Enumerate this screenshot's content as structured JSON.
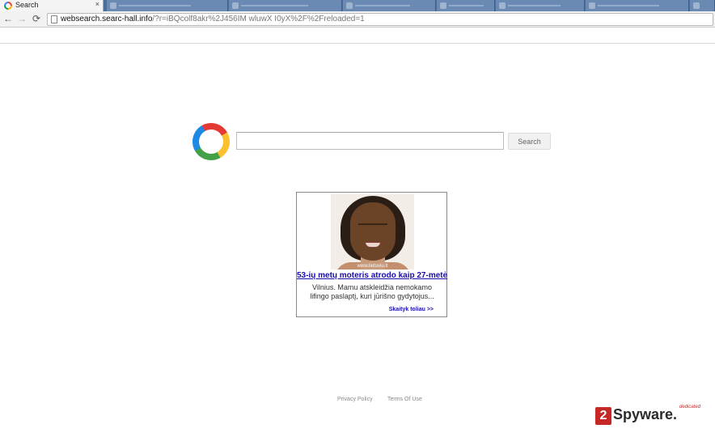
{
  "browser": {
    "active_tab": {
      "title": "Search",
      "close_glyph": "×"
    },
    "nav": {
      "back_glyph": "←",
      "forward_glyph": "→",
      "reload_glyph": "⟳"
    },
    "address_bar": {
      "url_host": "websearch.searc-hall.info",
      "url_rest": "/?r=iBQcolf8akr%2J456IM wluwX I0yX%2F%2Freloaded=1"
    }
  },
  "search": {
    "button_label": "Search",
    "query_value": ""
  },
  "ad": {
    "watermark": "www.lietuviu.lt",
    "headline": "53-ių metų moteris atrodo kaip 27-metė",
    "body": "Vilnius. Mamu atskleidžia nemokamo lifingo paslaptį, kuri jūrišno gydytojus...",
    "more_link": "Skaityk toliau >>"
  },
  "footer": {
    "privacy_label": "Privacy Policy",
    "terms_label": "Terms Of Use"
  },
  "watermark_brand": {
    "digit": "2",
    "name": "Spyware.",
    "tag": "dedicated"
  },
  "colors": {
    "tabstrip": "#4b6f9c",
    "link": "#1a0dab",
    "brand_red": "#c62828"
  },
  "icons": [
    "page-favicon",
    "back-arrow-icon",
    "forward-arrow-icon",
    "reload-icon",
    "page-icon",
    "search-logo-ring"
  ]
}
